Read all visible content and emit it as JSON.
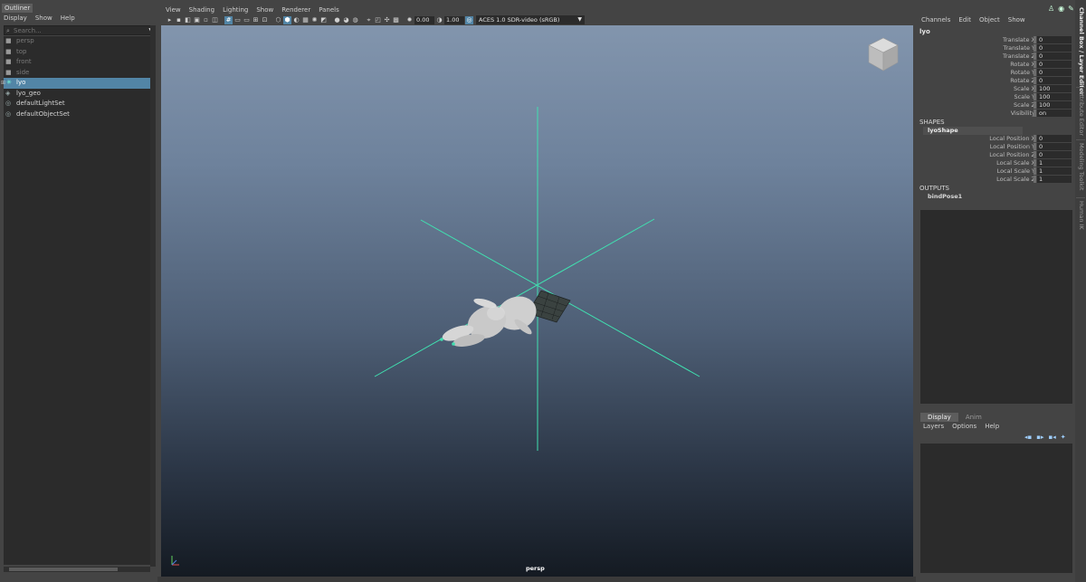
{
  "outliner": {
    "tab": "Outliner",
    "menu": [
      "Display",
      "Show",
      "Help"
    ],
    "search_placeholder": "Search...",
    "items": [
      {
        "label": "persp",
        "icon": "camera-icon",
        "dim": true
      },
      {
        "label": "top",
        "icon": "camera-icon",
        "dim": true
      },
      {
        "label": "front",
        "icon": "camera-icon",
        "dim": true
      },
      {
        "label": "side",
        "icon": "camera-icon",
        "dim": true
      },
      {
        "label": "lyo",
        "icon": "joint-icon",
        "selected": true
      },
      {
        "label": "lyo_geo",
        "icon": "mesh-icon"
      },
      {
        "label": "defaultLightSet",
        "icon": "set-icon"
      },
      {
        "label": "defaultObjectSet",
        "icon": "set-icon"
      }
    ]
  },
  "viewport": {
    "menu": [
      "View",
      "Shading",
      "Lighting",
      "Show",
      "Renderer",
      "Panels"
    ],
    "exposure": "0.00",
    "gamma": "1.00",
    "color_space": "ACES 1.0 SDR-video (sRGB)",
    "camera": "persp"
  },
  "channel_box": {
    "menu": [
      "Channels",
      "Edit",
      "Object",
      "Show"
    ],
    "node": "lyo",
    "attributes": [
      {
        "label": "Translate X",
        "value": "0"
      },
      {
        "label": "Translate Y",
        "value": "0"
      },
      {
        "label": "Translate Z",
        "value": "0"
      },
      {
        "label": "Rotate X",
        "value": "0"
      },
      {
        "label": "Rotate Y",
        "value": "0"
      },
      {
        "label": "Rotate Z",
        "value": "0"
      },
      {
        "label": "Scale X",
        "value": "100"
      },
      {
        "label": "Scale Y",
        "value": "100"
      },
      {
        "label": "Scale Z",
        "value": "100"
      },
      {
        "label": "Visibility",
        "value": "on"
      }
    ],
    "shapes_label": "SHAPES",
    "shape_node": "lyoShape",
    "shape_attributes": [
      {
        "label": "Local Position X",
        "value": "0"
      },
      {
        "label": "Local Position Y",
        "value": "0"
      },
      {
        "label": "Local Position Z",
        "value": "0"
      },
      {
        "label": "Local Scale X",
        "value": "1"
      },
      {
        "label": "Local Scale Y",
        "value": "1"
      },
      {
        "label": "Local Scale Z",
        "value": "1"
      }
    ],
    "outputs_label": "OUTPUTS",
    "output_node": "bindPose1"
  },
  "layer_editor": {
    "tabs": [
      "Display",
      "Anim"
    ],
    "menu": [
      "Layers",
      "Options",
      "Help"
    ]
  },
  "side_tabs": [
    "Channel Box / Layer Editor",
    "Attribute Editor",
    "Modeling Toolkit",
    "Human IK"
  ],
  "colors": {
    "selection": "#5285a6",
    "joint": "#40e0b0"
  }
}
